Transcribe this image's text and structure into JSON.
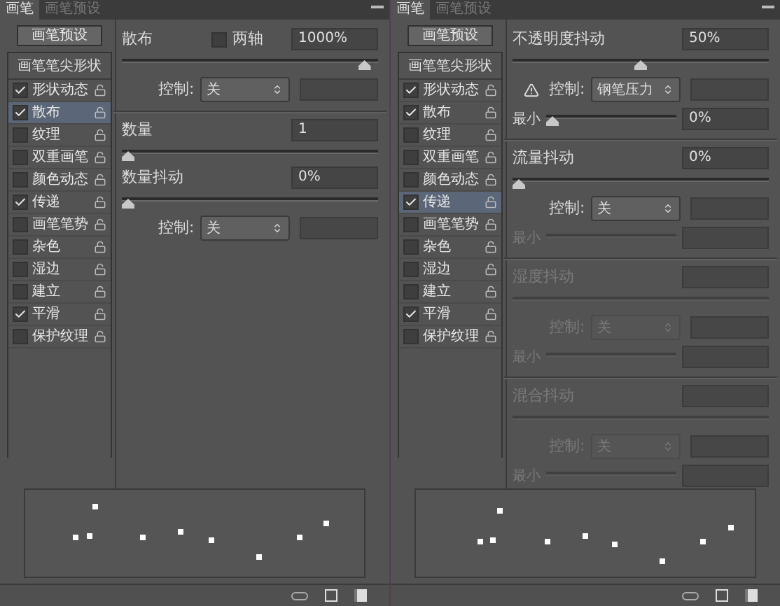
{
  "panels": [
    {
      "tabs": [
        {
          "label": "画笔",
          "selected": true
        },
        {
          "label": "画笔预设",
          "selected": false
        }
      ],
      "preset_button": "画笔预设",
      "list": [
        {
          "kind": "header",
          "label": "画笔笔尖形状",
          "selected": false
        },
        {
          "kind": "option",
          "label": "形状动态",
          "checked": true,
          "selected": false
        },
        {
          "kind": "option",
          "label": "散布",
          "checked": true,
          "selected": true
        },
        {
          "kind": "option",
          "label": "纹理",
          "checked": false,
          "selected": false
        },
        {
          "kind": "option",
          "label": "双重画笔",
          "checked": false,
          "selected": false
        },
        {
          "kind": "option",
          "label": "颜色动态",
          "checked": false,
          "selected": false
        },
        {
          "kind": "option",
          "label": "传递",
          "checked": true,
          "selected": false
        },
        {
          "kind": "option",
          "label": "画笔笔势",
          "checked": false,
          "selected": false
        },
        {
          "kind": "option",
          "label": "杂色",
          "checked": false,
          "selected": false
        },
        {
          "kind": "option",
          "label": "湿边",
          "checked": false,
          "selected": false
        },
        {
          "kind": "option",
          "label": "建立",
          "checked": false,
          "selected": false
        },
        {
          "kind": "option",
          "label": "平滑",
          "checked": true,
          "selected": false
        },
        {
          "kind": "option",
          "label": "保护纹理",
          "checked": false,
          "selected": false
        }
      ],
      "settings": [
        {
          "kind": "header",
          "label": "散布",
          "value": "1000%",
          "disabled": false,
          "checkbox": {
            "label": "两轴",
            "checked": false
          }
        },
        {
          "kind": "slider",
          "level": 0.97,
          "disabled": false
        },
        {
          "kind": "control",
          "label": "控制:",
          "value": "关",
          "warning": false,
          "disabled": false
        },
        {
          "kind": "divider"
        },
        {
          "kind": "header",
          "label": "数量",
          "value": "1",
          "disabled": false
        },
        {
          "kind": "slider",
          "level": 0,
          "disabled": false
        },
        {
          "kind": "header",
          "label": "数量抖动",
          "value": "0%",
          "disabled": false
        },
        {
          "kind": "slider",
          "level": 0,
          "disabled": false
        },
        {
          "kind": "control",
          "label": "控制:",
          "value": "关",
          "warning": false,
          "disabled": false
        }
      ]
    },
    {
      "tabs": [
        {
          "label": "画笔",
          "selected": true
        },
        {
          "label": "画笔预设",
          "selected": false
        }
      ],
      "preset_button": "画笔预设",
      "list": [
        {
          "kind": "header",
          "label": "画笔笔尖形状",
          "selected": false
        },
        {
          "kind": "option",
          "label": "形状动态",
          "checked": true,
          "selected": false
        },
        {
          "kind": "option",
          "label": "散布",
          "checked": true,
          "selected": false
        },
        {
          "kind": "option",
          "label": "纹理",
          "checked": false,
          "selected": false
        },
        {
          "kind": "option",
          "label": "双重画笔",
          "checked": false,
          "selected": false
        },
        {
          "kind": "option",
          "label": "颜色动态",
          "checked": false,
          "selected": false
        },
        {
          "kind": "option",
          "label": "传递",
          "checked": true,
          "selected": true
        },
        {
          "kind": "option",
          "label": "画笔笔势",
          "checked": false,
          "selected": false
        },
        {
          "kind": "option",
          "label": "杂色",
          "checked": false,
          "selected": false
        },
        {
          "kind": "option",
          "label": "湿边",
          "checked": false,
          "selected": false
        },
        {
          "kind": "option",
          "label": "建立",
          "checked": false,
          "selected": false
        },
        {
          "kind": "option",
          "label": "平滑",
          "checked": true,
          "selected": false
        },
        {
          "kind": "option",
          "label": "保护纹理",
          "checked": false,
          "selected": false
        }
      ],
      "settings": [
        {
          "kind": "header",
          "label": "不透明度抖动",
          "value": "50%",
          "disabled": false
        },
        {
          "kind": "slider",
          "level": 0.5,
          "disabled": false
        },
        {
          "kind": "control",
          "label": "控制:",
          "value": "钢笔压力",
          "warning": true,
          "disabled": false
        },
        {
          "kind": "min",
          "label": "最小",
          "level": 0,
          "value": "0%",
          "disabled": false
        },
        {
          "kind": "divider"
        },
        {
          "kind": "header",
          "label": "流量抖动",
          "value": "0%",
          "disabled": false
        },
        {
          "kind": "slider",
          "level": 0,
          "disabled": false
        },
        {
          "kind": "control",
          "label": "控制:",
          "value": "关",
          "warning": false,
          "disabled": false
        },
        {
          "kind": "min",
          "label": "最小",
          "disabled": true
        },
        {
          "kind": "divider"
        },
        {
          "kind": "header",
          "label": "湿度抖动",
          "disabled": true
        },
        {
          "kind": "slider",
          "disabled": true
        },
        {
          "kind": "control",
          "label": "控制:",
          "value": "关",
          "warning": false,
          "disabled": true
        },
        {
          "kind": "min",
          "label": "最小",
          "disabled": true
        },
        {
          "kind": "divider"
        },
        {
          "kind": "header",
          "label": "混合抖动",
          "disabled": true
        },
        {
          "kind": "slider",
          "disabled": true
        },
        {
          "kind": "control",
          "label": "控制:",
          "value": "关",
          "warning": false,
          "disabled": true
        },
        {
          "kind": "min",
          "label": "最小",
          "disabled": true
        }
      ]
    }
  ]
}
